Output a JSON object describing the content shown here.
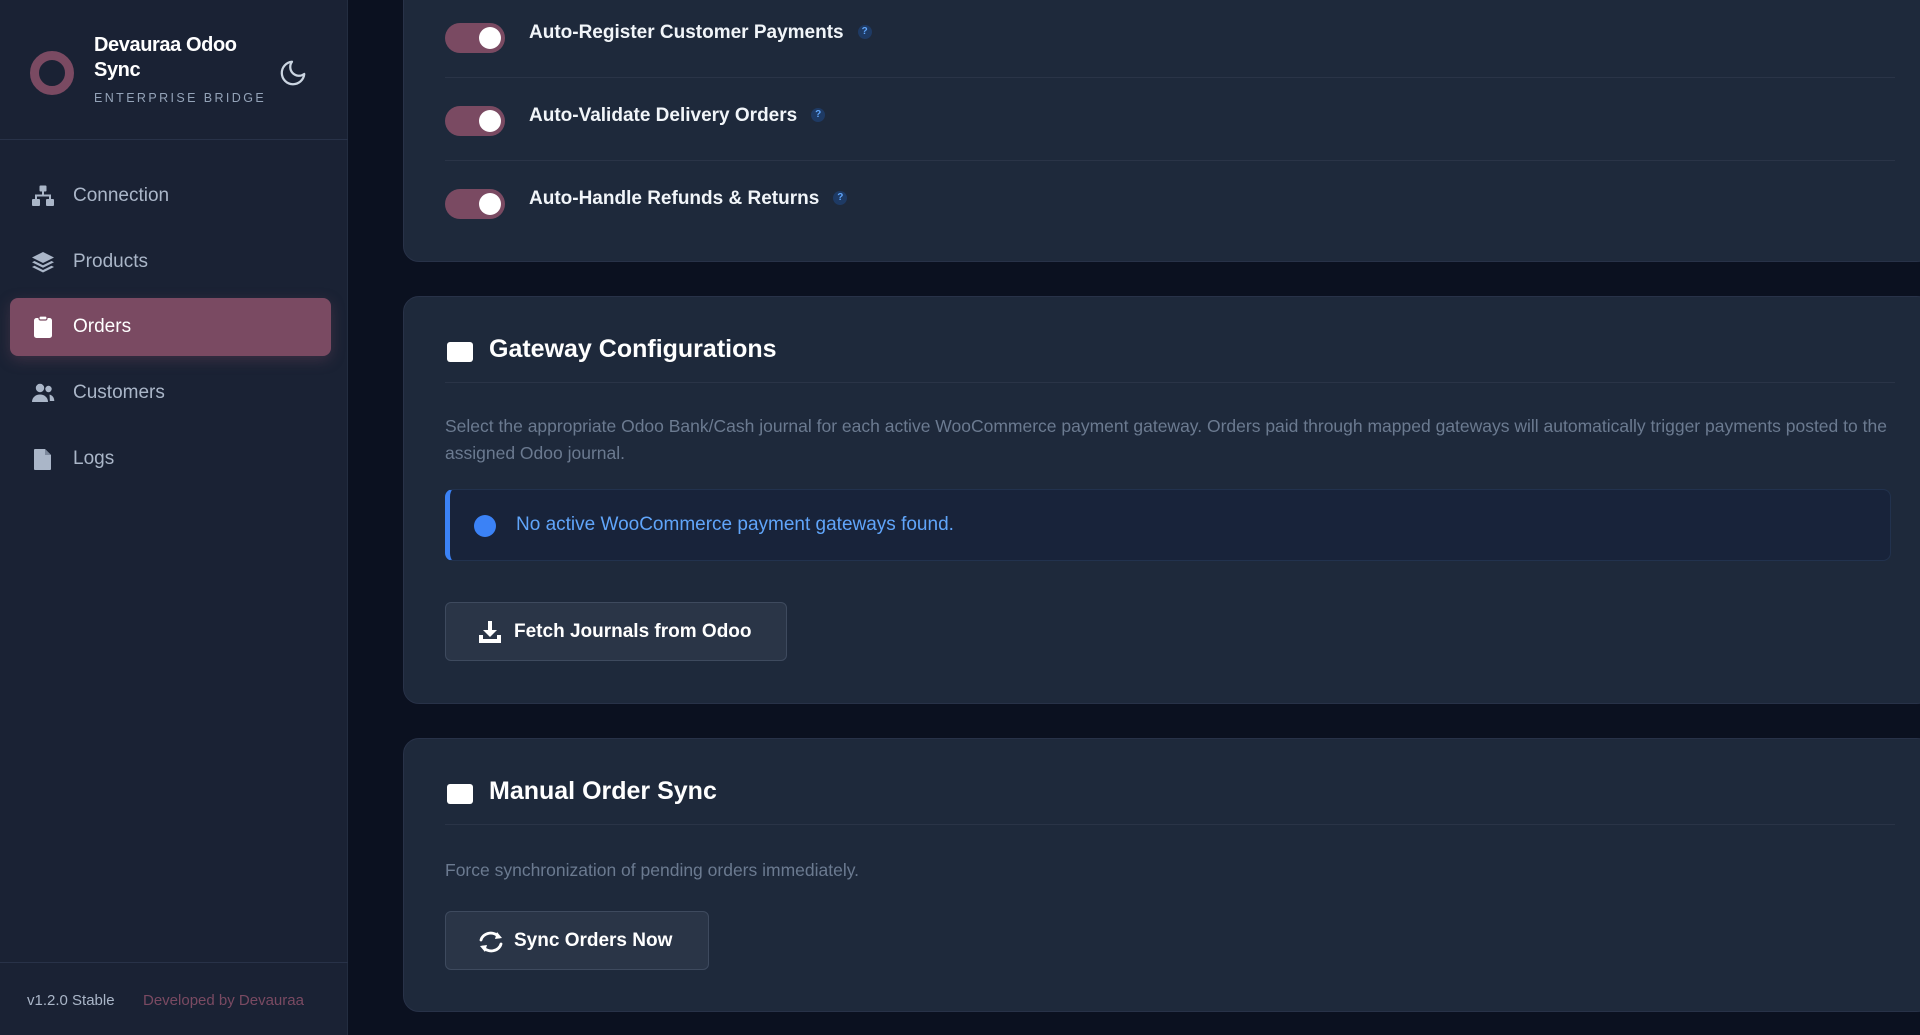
{
  "sidebar": {
    "brand_title": "Devauraa Odoo Sync",
    "brand_subtitle": "ENTERPRISE BRIDGE",
    "nav": [
      {
        "label": "Connection",
        "icon": "sitemap-icon",
        "active": false
      },
      {
        "label": "Products",
        "icon": "layers-icon",
        "active": false
      },
      {
        "label": "Orders",
        "icon": "clipboard-icon",
        "active": true
      },
      {
        "label": "Customers",
        "icon": "users-icon",
        "active": false
      },
      {
        "label": "Logs",
        "icon": "file-icon",
        "active": false
      }
    ],
    "version": "v1.2.0 Stable",
    "developer": "Developed by Devauraa"
  },
  "automation": {
    "toggles": [
      {
        "label": "Auto-Register Customer Payments",
        "enabled": true,
        "help": "?"
      },
      {
        "label": "Auto-Validate Delivery Orders",
        "enabled": true,
        "help": "?"
      },
      {
        "label": "Auto-Handle Refunds & Returns",
        "enabled": true,
        "help": "?"
      }
    ]
  },
  "gateway": {
    "title": "Gateway Configurations",
    "description": "Select the appropriate Odoo Bank/Cash journal for each active WooCommerce payment gateway. Orders paid through mapped gateways will automatically trigger payments posted to the assigned Odoo journal.",
    "notice": "No active WooCommerce payment gateways found.",
    "fetch_button": "Fetch Journals from Odoo"
  },
  "manual_sync": {
    "title": "Manual Order Sync",
    "description": "Force synchronization of pending orders immediately.",
    "sync_button": "Sync Orders Now"
  },
  "colors": {
    "accent": "#7a4a62",
    "background": "#0b1120",
    "card": "#1e293b",
    "sidebar": "#1a2234",
    "info": "#3b82f6"
  }
}
